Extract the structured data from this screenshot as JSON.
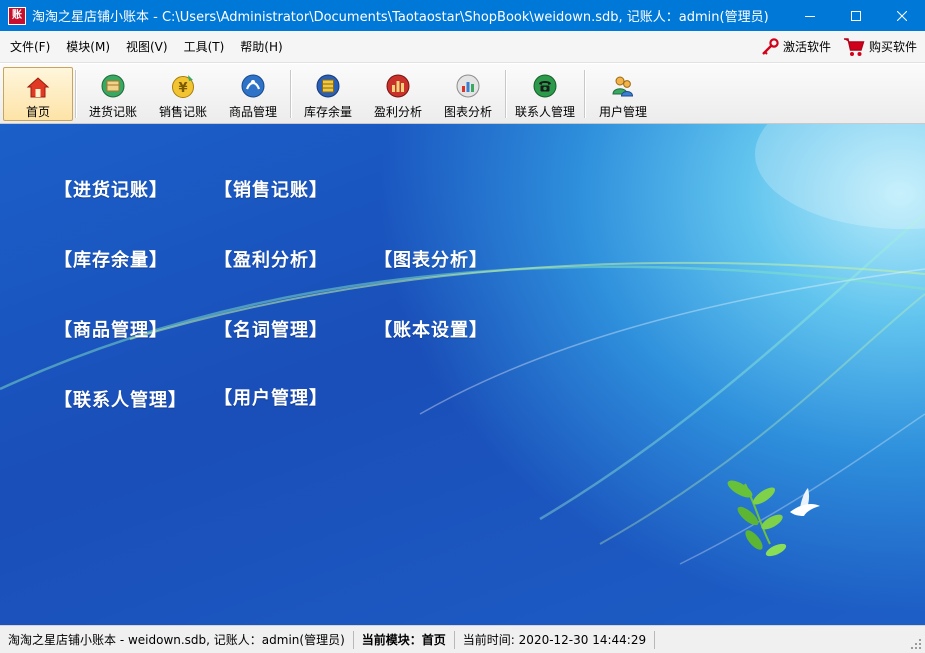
{
  "window": {
    "title": "淘淘之星店铺小账本 - C:\\Users\\Administrator\\Documents\\Taotaostar\\ShopBook\\weidown.sdb,  记账人：admin(管理员)",
    "app_icon_text": "账"
  },
  "menu": {
    "items": [
      {
        "label": "文件(F)"
      },
      {
        "label": "模块(M)"
      },
      {
        "label": "视图(V)"
      },
      {
        "label": "工具(T)"
      },
      {
        "label": "帮助(H)"
      }
    ],
    "activate_label": "激活软件",
    "buy_label": "购买软件"
  },
  "toolbar": {
    "items": [
      {
        "label": "首页",
        "icon": "home-icon"
      },
      {
        "label": "进货记账",
        "icon": "purchase-icon"
      },
      {
        "label": "销售记账",
        "icon": "sales-icon"
      },
      {
        "label": "商品管理",
        "icon": "goods-icon"
      },
      {
        "label": "库存余量",
        "icon": "stock-icon"
      },
      {
        "label": "盈利分析",
        "icon": "profit-icon"
      },
      {
        "label": "图表分析",
        "icon": "chart-icon"
      },
      {
        "label": "联系人管理",
        "icon": "contacts-icon"
      },
      {
        "label": "用户管理",
        "icon": "users-icon"
      }
    ]
  },
  "main": {
    "links": [
      {
        "label": "【进货记账】"
      },
      {
        "label": "【销售记账】"
      },
      {
        "label": "【库存余量】"
      },
      {
        "label": "【盈利分析】"
      },
      {
        "label": "【图表分析】"
      },
      {
        "label": "【商品管理】"
      },
      {
        "label": "【名词管理】"
      },
      {
        "label": "【账本设置】"
      },
      {
        "label": "【联系人管理】"
      },
      {
        "label": "【用户管理】"
      }
    ]
  },
  "status": {
    "file_info": "淘淘之星店铺小账本 - weidown.sdb,  记账人：admin(管理员)",
    "module_label": "当前模块：",
    "module_value": "首页",
    "time_label": "当前时间:",
    "time_value": "2020-12-30 14:44:29"
  },
  "colors": {
    "titlebar": "#0078d7",
    "main_bg": "#1a4eb8",
    "link_text": "#ffffff"
  }
}
